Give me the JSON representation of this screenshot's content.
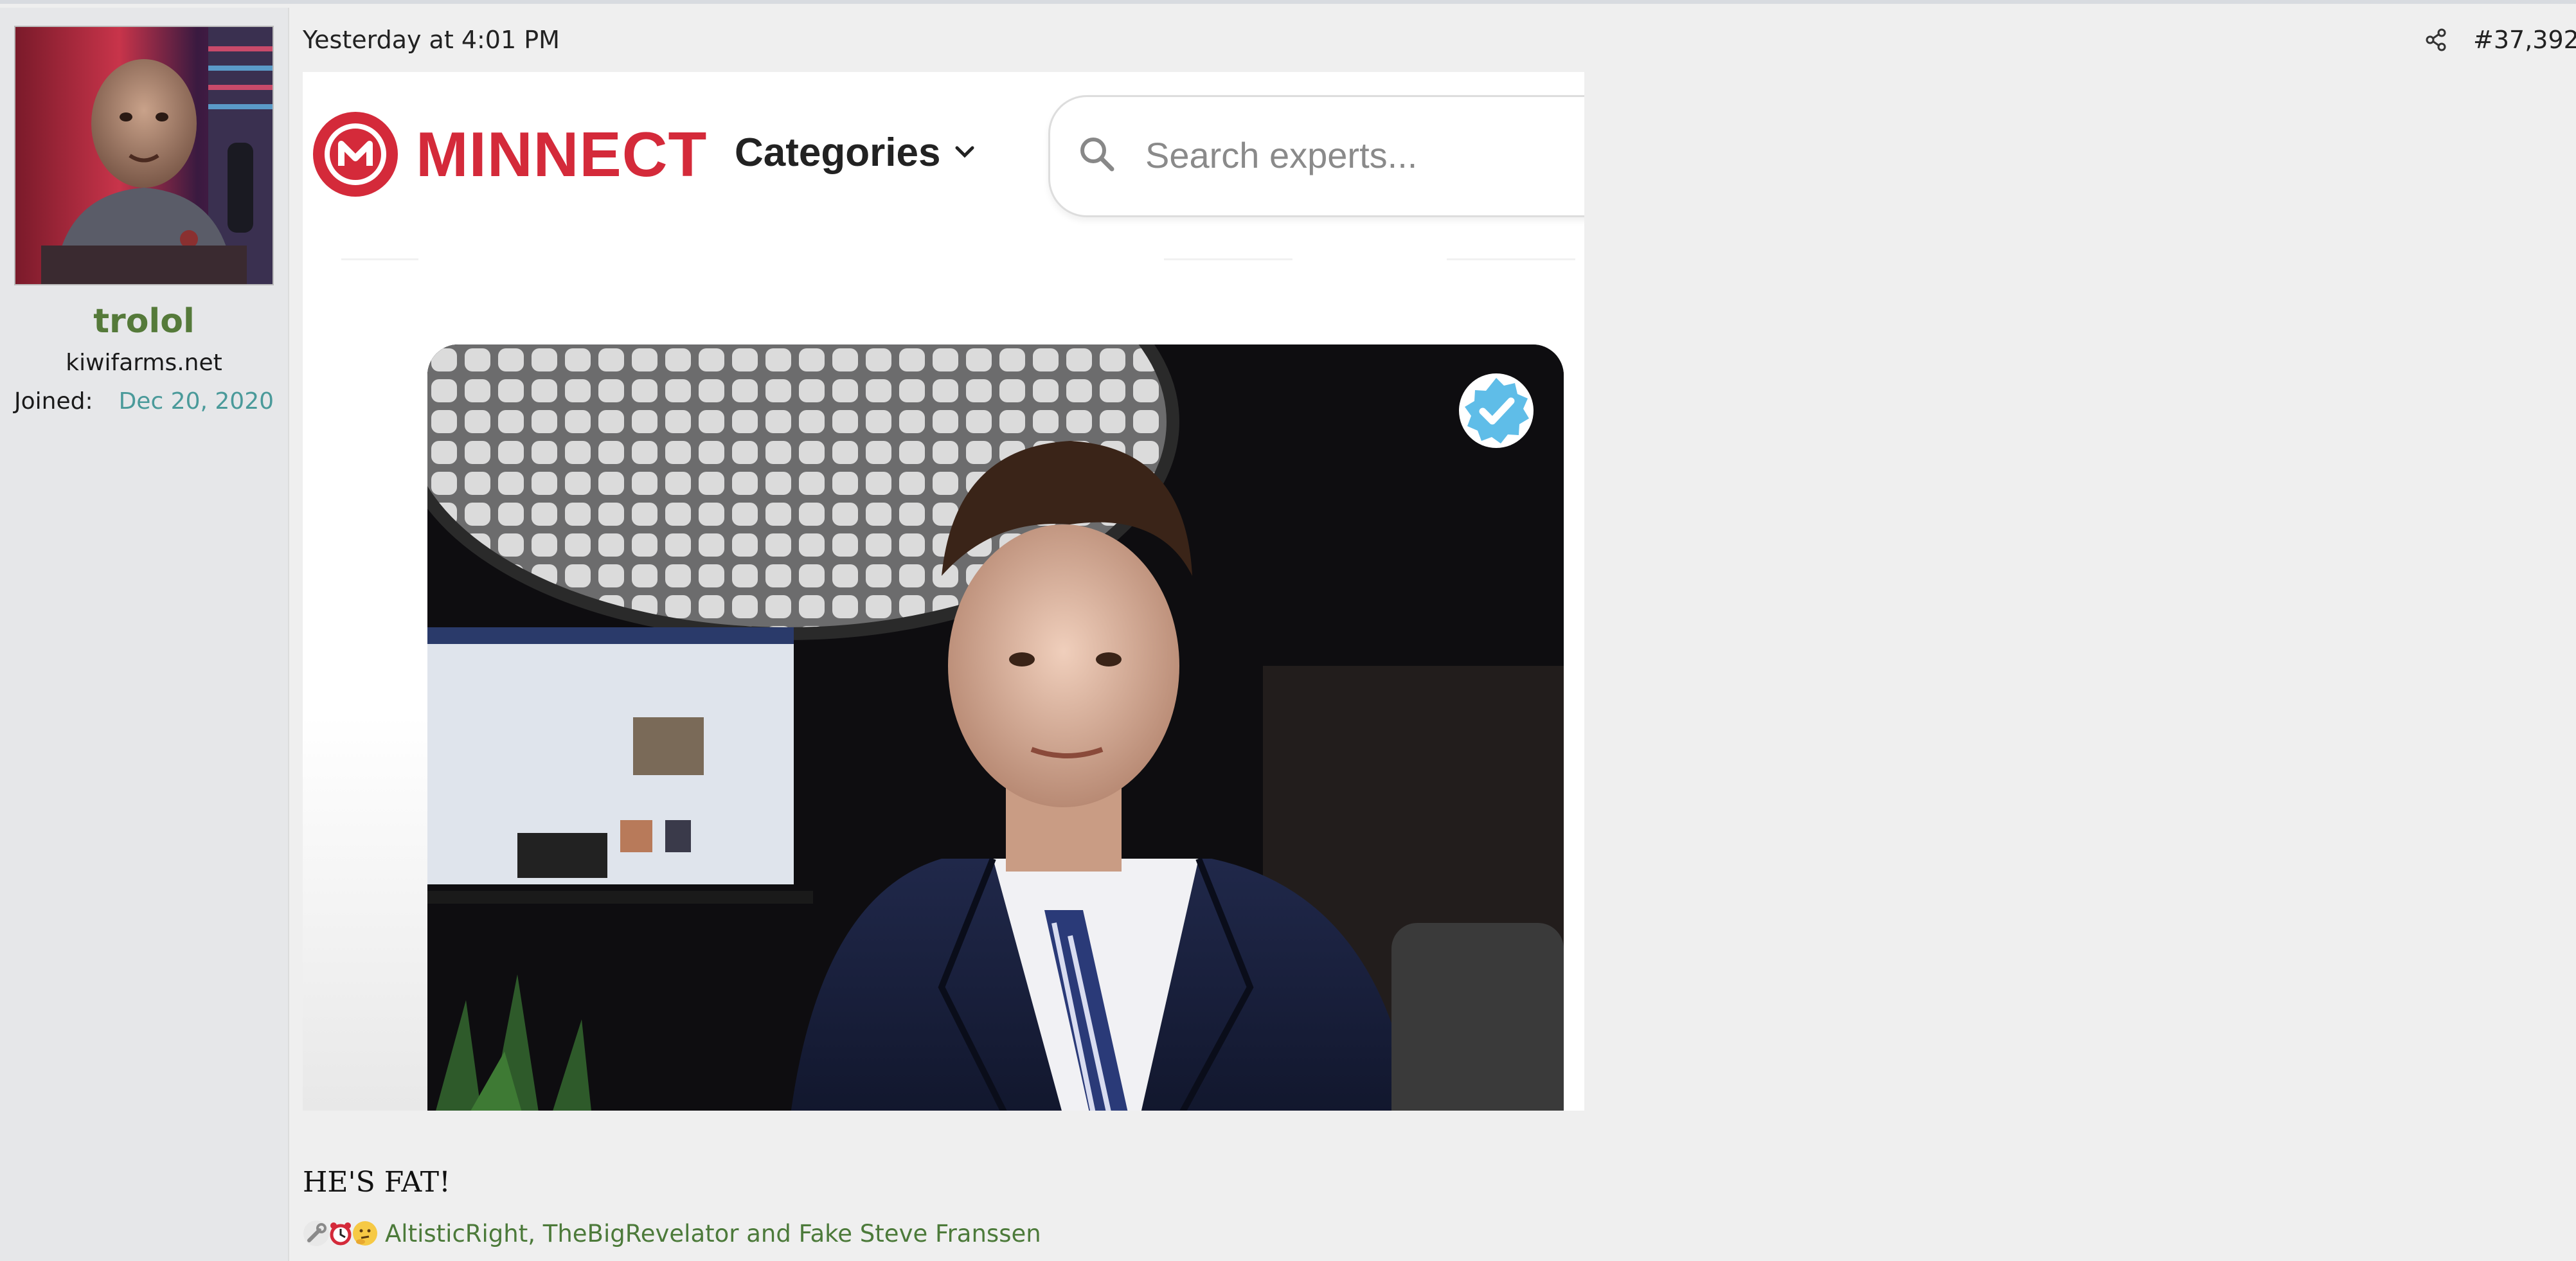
{
  "user": {
    "username": "trolol",
    "title": "kiwifarms.net",
    "joined_label": "Joined:",
    "joined_date": "Dec 20, 2020"
  },
  "post": {
    "timestamp": "Yesterday at 4:01 PM",
    "number": "#37,392",
    "body_text": "HE'S FAT!",
    "reactions_text": "AltisticRight, TheBigRevelator and Fake Steve Franssen"
  },
  "embedded_image": {
    "brand": "MINNECT",
    "categories_label": "Categories",
    "search_placeholder": "Search experts..."
  },
  "icons": {
    "share": "share-icon",
    "search": "search-icon",
    "chevron": "chevron-down-icon",
    "verified": "verified-badge-icon",
    "reactions": [
      "wrench-icon",
      "alarm-clock-icon",
      "thinking-face-icon"
    ]
  },
  "colors": {
    "username": "#557a3a",
    "joined_date": "#4a9a9a",
    "brand_red": "#d42a3a",
    "reaction_link": "#4c7a3a",
    "verified_blue": "#5fbde8"
  }
}
